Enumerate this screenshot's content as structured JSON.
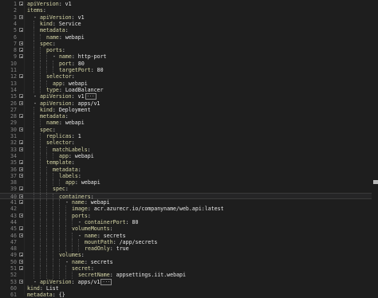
{
  "editor": {
    "lines": [
      {
        "n": "1",
        "text": "apiVersion: v1",
        "indent": 0,
        "fold": true,
        "key": "apiVersion",
        "value": "v1"
      },
      {
        "n": "2",
        "text": "items:",
        "indent": 0,
        "key": "items",
        "value": ""
      },
      {
        "n": "3",
        "indent": 1,
        "fold": true,
        "dash": true,
        "key": "apiVersion",
        "value": "v1"
      },
      {
        "n": "4",
        "indent": 2,
        "key": "kind",
        "value": "Service"
      },
      {
        "n": "5",
        "indent": 2,
        "fold": true,
        "key": "metadata",
        "value": ""
      },
      {
        "n": "6",
        "indent": 3,
        "key": "name",
        "value": "webapi"
      },
      {
        "n": "7",
        "indent": 2,
        "fold": true,
        "key": "spec",
        "value": ""
      },
      {
        "n": "8",
        "indent": 3,
        "fold": true,
        "key": "ports",
        "value": ""
      },
      {
        "n": "9",
        "indent": 4,
        "fold": true,
        "dash": true,
        "key": "name",
        "value": "http-port"
      },
      {
        "n": "10",
        "indent": 5,
        "key": "port",
        "value": "80"
      },
      {
        "n": "11",
        "indent": 5,
        "key": "targetPort",
        "value": "80"
      },
      {
        "n": "12",
        "indent": 3,
        "fold": true,
        "key": "selector",
        "value": ""
      },
      {
        "n": "13",
        "indent": 4,
        "key": "app",
        "value": "webapi"
      },
      {
        "n": "14",
        "indent": 3,
        "key": "type",
        "value": "LoadBalancer"
      },
      {
        "n": "15",
        "indent": 1,
        "fold": true,
        "dash": true,
        "key": "apiVersion",
        "value": "v1",
        "collapsed": "..."
      },
      {
        "n": "26",
        "indent": 1,
        "fold": true,
        "dash": true,
        "key": "apiVersion",
        "value": "apps/v1"
      },
      {
        "n": "27",
        "indent": 2,
        "key": "kind",
        "value": "Deployment"
      },
      {
        "n": "28",
        "indent": 2,
        "fold": true,
        "key": "metadata",
        "value": ""
      },
      {
        "n": "29",
        "indent": 3,
        "key": "name",
        "value": "webapi"
      },
      {
        "n": "30",
        "indent": 2,
        "fold": true,
        "key": "spec",
        "value": ""
      },
      {
        "n": "31",
        "indent": 3,
        "key": "replicas",
        "value": "1"
      },
      {
        "n": "32",
        "indent": 3,
        "fold": true,
        "key": "selector",
        "value": ""
      },
      {
        "n": "33",
        "indent": 4,
        "fold": true,
        "key": "matchLabels",
        "value": ""
      },
      {
        "n": "34",
        "indent": 5,
        "key": "app",
        "value": "webapi"
      },
      {
        "n": "35",
        "indent": 3,
        "fold": true,
        "key": "template",
        "value": ""
      },
      {
        "n": "36",
        "indent": 4,
        "fold": true,
        "key": "metadata",
        "value": ""
      },
      {
        "n": "37",
        "indent": 5,
        "fold": true,
        "key": "labels",
        "value": ""
      },
      {
        "n": "38",
        "indent": 6,
        "key": "app",
        "value": "webapi"
      },
      {
        "n": "39",
        "indent": 4,
        "fold": true,
        "key": "spec",
        "value": ""
      },
      {
        "n": "40",
        "indent": 5,
        "fold": true,
        "key": "containers",
        "value": "",
        "current": true
      },
      {
        "n": "41",
        "indent": 6,
        "fold": true,
        "dash": true,
        "key": "name",
        "value": "webapi"
      },
      {
        "n": "42",
        "indent": 7,
        "key": "image",
        "value": "acr.azurecr.io/companyname/web.api:latest"
      },
      {
        "n": "43",
        "indent": 7,
        "fold": true,
        "key": "ports",
        "value": ""
      },
      {
        "n": "44",
        "indent": 8,
        "dash": true,
        "key": "containerPort",
        "value": "80"
      },
      {
        "n": "45",
        "indent": 7,
        "fold": true,
        "key": "volumeMounts",
        "value": ""
      },
      {
        "n": "46",
        "indent": 8,
        "fold": true,
        "dash": true,
        "key": "name",
        "value": "secrets"
      },
      {
        "n": "47",
        "indent": 9,
        "key": "mountPath",
        "value": "/app/secrets"
      },
      {
        "n": "48",
        "indent": 9,
        "key": "readOnly",
        "value": "true"
      },
      {
        "n": "49",
        "indent": 5,
        "fold": true,
        "key": "volumes",
        "value": ""
      },
      {
        "n": "50",
        "indent": 6,
        "fold": true,
        "dash": true,
        "key": "name",
        "value": "secrets"
      },
      {
        "n": "51",
        "indent": 7,
        "fold": true,
        "key": "secret",
        "value": ""
      },
      {
        "n": "52",
        "indent": 8,
        "key": "secretName",
        "value": "appsettings.iit.webapi"
      },
      {
        "n": "53",
        "indent": 1,
        "fold": true,
        "dash": true,
        "key": "apiVersion",
        "value": "apps/v1",
        "collapsed": "..."
      },
      {
        "n": "60",
        "indent": 0,
        "key": "kind",
        "value": "List"
      },
      {
        "n": "61",
        "indent": 0,
        "key": "metadata",
        "value": "{}"
      }
    ]
  }
}
